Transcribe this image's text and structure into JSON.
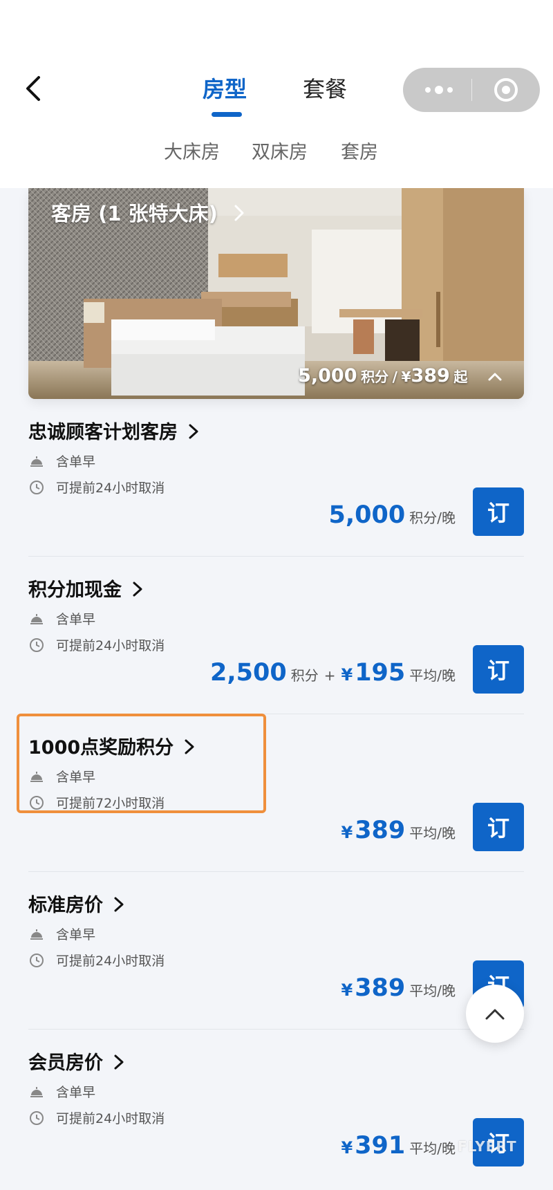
{
  "header": {
    "tabs": [
      {
        "label": "房型",
        "active": true
      },
      {
        "label": "套餐",
        "active": false
      }
    ],
    "sub_tabs": [
      "大床房",
      "双床房",
      "套房"
    ]
  },
  "room": {
    "title": "客房 (1 张特大床)",
    "points": "5,000",
    "points_unit": "积分",
    "separator": "/",
    "currency": "¥",
    "price": "389",
    "from_label": "起"
  },
  "rates": [
    {
      "name": "忠诚顾客计划客房",
      "breakfast": "含单早",
      "cancel": "可提前24小时取消",
      "price_main": "5,000",
      "price_unit": "积分/晚",
      "book": "订"
    },
    {
      "name": "积分加现金",
      "breakfast": "含单早",
      "cancel": "可提前24小时取消",
      "price_points": "2,500",
      "points_unit": "积分",
      "plus": "+",
      "currency": "¥",
      "price_cash": "195",
      "price_unit": "平均/晚",
      "book": "订"
    },
    {
      "name": "1000点奖励积分",
      "breakfast": "含单早",
      "cancel": "可提前72小时取消",
      "currency": "¥",
      "price": "389",
      "price_unit": "平均/晚",
      "book": "订"
    },
    {
      "name": "标准房价",
      "breakfast": "含单早",
      "cancel": "可提前24小时取消",
      "currency": "¥",
      "price": "389",
      "price_unit": "平均/晚",
      "book": "订"
    },
    {
      "name": "会员房价",
      "breakfast": "含单早",
      "cancel": "可提前24小时取消",
      "currency": "¥",
      "price": "391",
      "price_unit": "平均/晚",
      "book": "订"
    }
  ],
  "watermark": "FLYERT",
  "colors": {
    "accent": "#0f65c8",
    "highlight": "#ef8f3c",
    "background": "#f3f5f9"
  }
}
